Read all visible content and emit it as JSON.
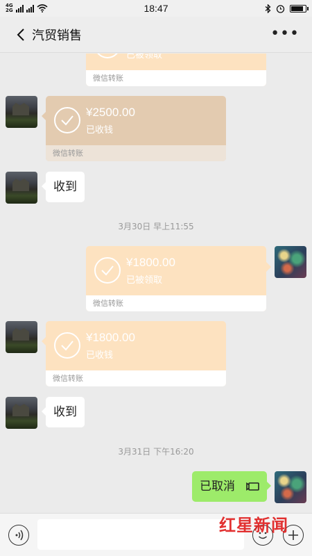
{
  "status_bar": {
    "network_top": "4G",
    "network_bottom": "2G",
    "speed": "2G",
    "time": "18:47",
    "battery_level": 0.85
  },
  "header": {
    "title": "汽贸销售",
    "more": "•••"
  },
  "messages": {
    "m0": {
      "state": "已被领取",
      "footer": "微信转账"
    },
    "m1": {
      "amount": "¥2500.00",
      "state": "已收钱",
      "footer": "微信转账"
    },
    "m2": {
      "text": "收到"
    },
    "ts1": "3月30日 早上11:55",
    "m3": {
      "amount": "¥1800.00",
      "state": "已被领取",
      "footer": "微信转账"
    },
    "m4": {
      "amount": "¥1800.00",
      "state": "已收钱",
      "footer": "微信转账"
    },
    "m5": {
      "text": "收到"
    },
    "ts2": "3月31日 下午16:20",
    "m6": {
      "text": "已取消"
    }
  },
  "input_bar": {
    "value": ""
  },
  "watermark": {
    "text": "红星新闻"
  },
  "colors": {
    "transfer_orange": "#fde2c0",
    "transfer_received": "#e3cbb0",
    "sent_green": "#9deb6a",
    "chat_bg": "#ebebeb",
    "watermark_red": "#e02020"
  }
}
